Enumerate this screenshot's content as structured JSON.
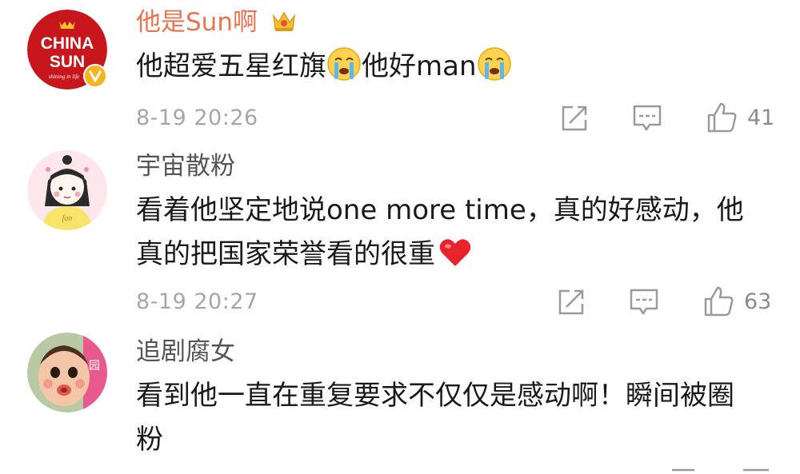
{
  "comments": [
    {
      "username": "他是Sun啊",
      "avatar": {
        "line1": "CHINA",
        "line2": "SUN",
        "tagline": "shining in life",
        "bg": "#c8161d",
        "badge": "verified-v-badge"
      },
      "text_a": "他超爱五星红旗",
      "text_b": "他好man",
      "time": "8-19 20:26",
      "likes": "41"
    },
    {
      "username": "宇宙散粉",
      "avatar": {
        "caption": "fan"
      },
      "line1": "看着他坚定地说one more time，真的好感动，他",
      "line2": "真的把国家荣誉看的很重",
      "time": "8-19 20:27",
      "likes": "63"
    },
    {
      "username": "追剧腐女",
      "line1": "看到他一直在重复要求不仅仅是感动啊！瞬间被圈",
      "line2": "粉"
    }
  ],
  "colors": {
    "username_vip": "#eb7350",
    "username_normal": "#555555",
    "meta_gray": "#a6a6a6",
    "icon_gray": "#9a9a9a"
  },
  "icons": [
    "crown-vip-icon",
    "crying-emoji-icon",
    "heart-emoji-icon",
    "share-icon",
    "comment-icon",
    "thumbs-up-icon"
  ]
}
